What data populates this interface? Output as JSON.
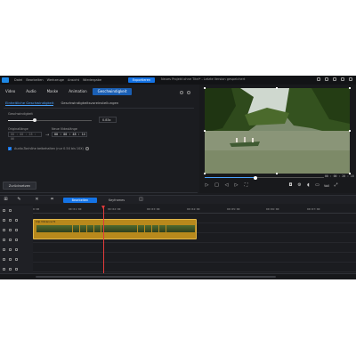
{
  "app": {
    "menu": [
      "Datei",
      "Bearbeiten",
      "Werkzeuge",
      "Ansicht",
      "Wiedergabe"
    ],
    "export_label": "Exportieren",
    "project_title": "Neues Projekt ohne Titel* - Letzte Version gespeichert"
  },
  "panel": {
    "tabs": [
      "Video",
      "Audio",
      "Maske",
      "Animation",
      "Geschwindigkeit"
    ],
    "active_tab": "Geschwindigkeit",
    "subtabs": [
      "Einheitliche Geschwindigkeit",
      "Geschwindigkeitsvoreinstellungen"
    ],
    "speed_label": "Geschwindigkeit",
    "speed_value": "0.83x",
    "speed_fraction": 0.3,
    "orig_length_label": "Originallänge",
    "orig_length_value": "00 : 00 : 28 : 06",
    "new_length_label": "Neue Videolänge",
    "new_length_value": "00 : 00 : 48 : 14",
    "audio_label": "Audio-Tonhöhe beibehalten (nur 0.5X bis 10X)",
    "reset_label": "Zurücksetzen"
  },
  "preview": {
    "timecode": "00 : 00 : 20 : 16",
    "scrub_fraction": 0.43,
    "quality": "Voll"
  },
  "toolbar": {
    "tab_edit": "Bearbeiten",
    "tab_keyframes": "Keyframes"
  },
  "timeline": {
    "ticks": [
      "0:00",
      "00:01:00",
      "00:02:00",
      "00:03:00",
      "00:04:00",
      "00:05:00",
      "00:06:00",
      "00:07:00"
    ],
    "clip_label": "Clip Vibrance Hi"
  },
  "colors": {
    "accent": "#1473e6",
    "clip": "#b8891c",
    "playhead": "#e23b3b"
  }
}
